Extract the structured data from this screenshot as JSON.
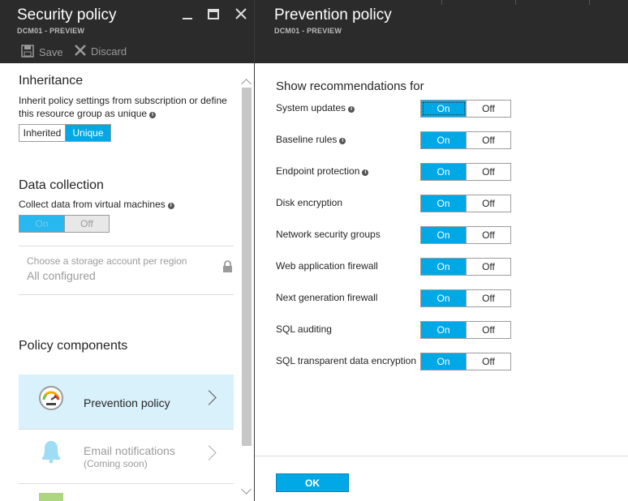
{
  "left_blade": {
    "title": "Security policy",
    "subtitle": "DCM01 - PREVIEW",
    "commands": {
      "save": "Save",
      "discard": "Discard"
    },
    "inheritance": {
      "heading": "Inheritance",
      "description_line1": "Inherit policy settings from subscription or define",
      "description_line2": "this resource group as unique",
      "options": [
        "Inherited",
        "Unique"
      ],
      "selected": "Unique"
    },
    "data_collection": {
      "heading": "Data collection",
      "description": "Collect data from virtual machines",
      "options": [
        "On",
        "Off"
      ],
      "selected": "On",
      "disabled": true
    },
    "storage": {
      "label": "Choose a storage account per region",
      "value": "All configured"
    },
    "policy_components": {
      "heading": "Policy components",
      "items": [
        {
          "label": "Prevention policy",
          "sublabel": "",
          "active": true
        },
        {
          "label": "Email notifications",
          "sublabel": "(Coming soon)",
          "active": false
        }
      ]
    }
  },
  "right_blade": {
    "title": "Prevention policy",
    "subtitle": "DCM01 - PREVIEW",
    "heading": "Show recommendations for",
    "toggle_options": [
      "On",
      "Off"
    ],
    "rows": [
      {
        "label": "System updates",
        "info": true,
        "selected": "On"
      },
      {
        "label": "Baseline rules",
        "info": true,
        "selected": "On"
      },
      {
        "label": "Endpoint protection",
        "info": true,
        "selected": "On"
      },
      {
        "label": "Disk encryption",
        "info": false,
        "selected": "On"
      },
      {
        "label": "Network security groups",
        "info": false,
        "selected": "On"
      },
      {
        "label": "Web application firewall",
        "info": false,
        "selected": "On"
      },
      {
        "label": "Next generation firewall",
        "info": false,
        "selected": "On"
      },
      {
        "label": "SQL auditing",
        "info": false,
        "selected": "On"
      },
      {
        "label": "SQL transparent data encryption",
        "info": false,
        "selected": "On"
      }
    ],
    "ok_label": "OK"
  },
  "colors": {
    "accent": "#00a9e6",
    "header_bg": "#2b2b2b",
    "active_item_bg": "#d9f1fb"
  },
  "icons": [
    "minimize-icon",
    "maximize-icon",
    "close-icon",
    "save-icon",
    "discard-icon",
    "info-icon",
    "lock-icon",
    "gauge-icon",
    "bell-icon",
    "chevron-right-icon"
  ]
}
